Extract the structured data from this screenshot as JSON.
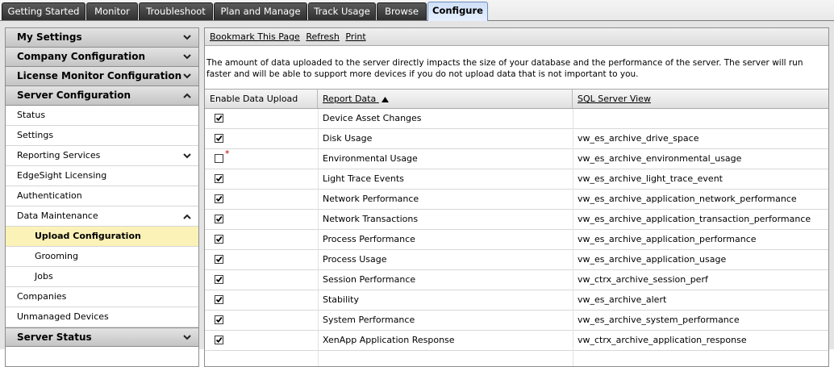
{
  "tabs": [
    {
      "label": "Getting Started",
      "active": false
    },
    {
      "label": "Monitor",
      "active": false
    },
    {
      "label": "Troubleshoot",
      "active": false
    },
    {
      "label": "Plan and Manage",
      "active": false
    },
    {
      "label": "Track Usage",
      "active": false
    },
    {
      "label": "Browse",
      "active": false
    },
    {
      "label": "Configure",
      "active": true
    }
  ],
  "sidebar": {
    "sections": [
      {
        "label": "My Settings",
        "icon": "chevron-down-icon"
      },
      {
        "label": "Company Configuration",
        "icon": "chevron-down-icon"
      },
      {
        "label": "License Monitor Configuration",
        "icon": "chevron-down-icon"
      },
      {
        "label": "Server Configuration",
        "icon": "chevron-up-icon"
      },
      {
        "label": "Server Status",
        "icon": "chevron-down-icon"
      }
    ],
    "items": [
      {
        "label": "Status"
      },
      {
        "label": "Settings"
      },
      {
        "label": "Reporting Services",
        "icon": "chevron-down-icon"
      },
      {
        "label": "EdgeSight Licensing"
      },
      {
        "label": "Authentication"
      },
      {
        "label": "Data Maintenance",
        "icon": "chevron-up-icon"
      },
      {
        "label": "Upload Configuration",
        "selected": true
      },
      {
        "label": "Grooming"
      },
      {
        "label": "Jobs"
      },
      {
        "label": "Companies"
      },
      {
        "label": "Unmanaged Devices"
      }
    ]
  },
  "toolbar": {
    "bookmark": "Bookmark This Page",
    "refresh": "Refresh",
    "print": "Print"
  },
  "description": "The amount of data uploaded to the server directly impacts the size of your database and the performance of the server. The server will run faster and will be able to support more devices if you do not upload data that is not important to you.",
  "table": {
    "columns": {
      "enable": "Enable Data Upload",
      "report": "Report Data",
      "view": "SQL Server View"
    },
    "sort": {
      "column": "report",
      "direction": "ascending",
      "icon": "sort-up-icon"
    },
    "rows": [
      {
        "checked": true,
        "required_mark": "",
        "report": "Device Asset Changes",
        "view": ""
      },
      {
        "checked": true,
        "required_mark": "",
        "report": "Disk Usage",
        "view": "vw_es_archive_drive_space"
      },
      {
        "checked": false,
        "required_mark": "*",
        "report": "Environmental Usage",
        "view": "vw_es_archive_environmental_usage"
      },
      {
        "checked": true,
        "required_mark": "",
        "report": "Light Trace Events",
        "view": "vw_es_archive_light_trace_event"
      },
      {
        "checked": true,
        "required_mark": "",
        "report": "Network Performance",
        "view": "vw_es_archive_application_network_performance"
      },
      {
        "checked": true,
        "required_mark": "",
        "report": "Network Transactions",
        "view": "vw_es_archive_application_transaction_performance"
      },
      {
        "checked": true,
        "required_mark": "",
        "report": "Process Performance",
        "view": "vw_es_archive_application_performance"
      },
      {
        "checked": true,
        "required_mark": "",
        "report": "Process Usage",
        "view": "vw_es_archive_application_usage"
      },
      {
        "checked": true,
        "required_mark": "",
        "report": "Session Performance",
        "view": "vw_ctrx_archive_session_perf"
      },
      {
        "checked": true,
        "required_mark": "",
        "report": "Stability",
        "view": "vw_es_archive_alert"
      },
      {
        "checked": true,
        "required_mark": "",
        "report": "System Performance",
        "view": "vw_es_archive_system_performance"
      },
      {
        "checked": true,
        "required_mark": "",
        "report": "XenApp Application Response",
        "view": "vw_ctrx_archive_application_response"
      }
    ]
  },
  "colors": {
    "selected_item": "#fbf2b7",
    "active_tab": "#d9e6fa",
    "required_mark": "#c00000"
  }
}
